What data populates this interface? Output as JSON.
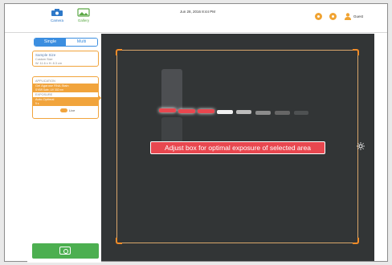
{
  "header": {
    "nav": [
      {
        "label": "Camera",
        "icon": "camera-icon"
      },
      {
        "label": "Gallery",
        "icon": "gallery-icon"
      }
    ],
    "datetime": "Jun 28, 2016   8:44 PM",
    "actions": [
      "settings-icon",
      "help-icon"
    ],
    "user_label": "Guest"
  },
  "sidebar": {
    "segment": {
      "left": "Single",
      "right": "Multi"
    },
    "sample": {
      "title": "Sample Size",
      "subtitle": "Custom Size",
      "detail": "W: 11.6 x H: 8.3 cm"
    },
    "application": {
      "section1": "APPLICATION",
      "app_name": "Gel Agarose RNA Stain",
      "app_sub": "SYBR Safe, UV 302 nm",
      "section2": "EXPOSURE",
      "exposure_name": "Auto-Optimal",
      "exposure_sub": "5 s",
      "toggle_label": "Live"
    },
    "capture_icon": "camera-icon"
  },
  "viewer": {
    "toast_message": "Adjust box for optimal exposure of selected area",
    "brightness_icon": "sun-icon",
    "colors": {
      "background": "#323536",
      "crop_corner": "#f28c28",
      "toast": "#e8474f",
      "saturated": "#e8474f"
    }
  }
}
